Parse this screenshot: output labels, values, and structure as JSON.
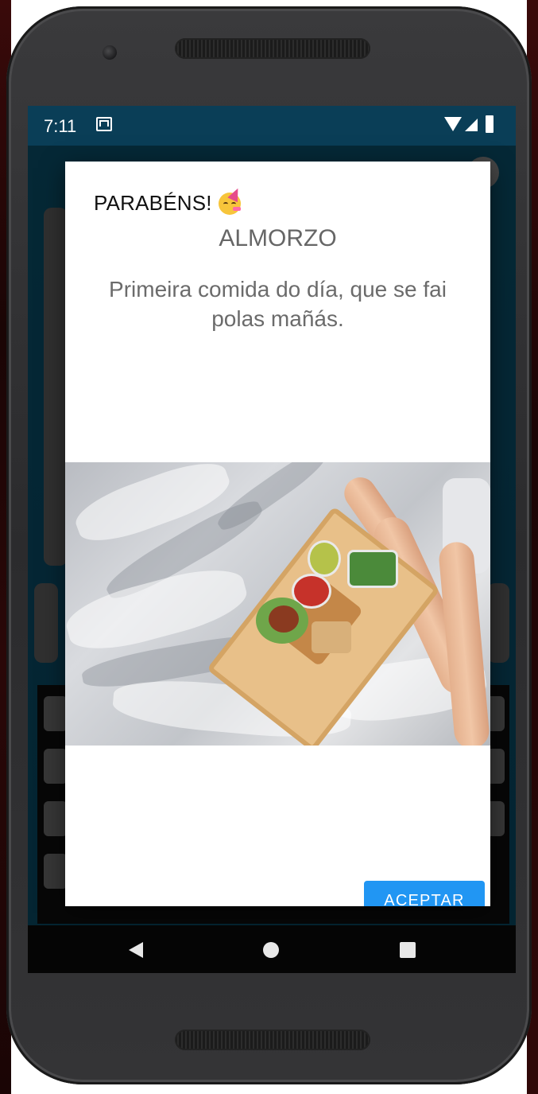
{
  "status_bar": {
    "time": "7:11",
    "icons": [
      "gmail-icon",
      "wifi-icon",
      "signal-icon",
      "battery-icon"
    ]
  },
  "dialog": {
    "title": "PARABÉNS!",
    "title_icon": "party-face-icon",
    "subtitle": "ALMORZO",
    "description": "Primeira comida do día, que se fai polas mañás.",
    "image_subject": "breakfast-tray-in-bed",
    "button_label": "ACEPTAR"
  },
  "nav_bar": {
    "icons": [
      "back-icon",
      "home-icon",
      "recents-icon"
    ]
  },
  "colors": {
    "status_bar": "#0a3e57",
    "app_background": "#0d5a78",
    "accent_button": "#2196f3",
    "dialog_background": "#ffffff"
  }
}
